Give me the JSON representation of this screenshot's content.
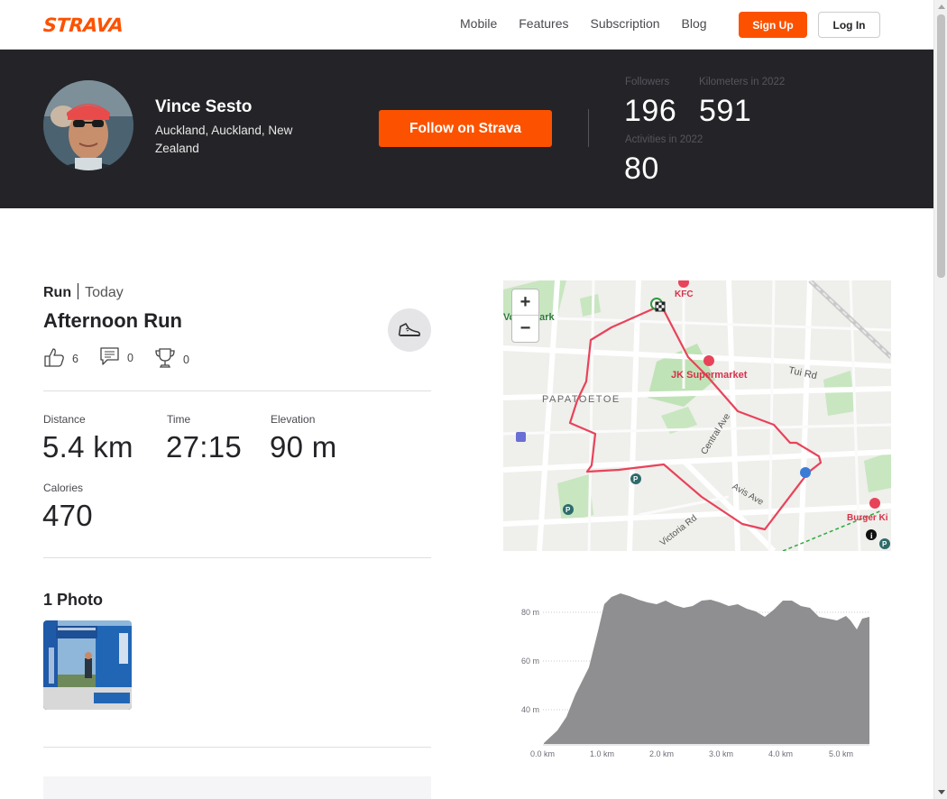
{
  "nav": {
    "logo": "STRAVA",
    "links": [
      "Mobile",
      "Features",
      "Subscription",
      "Blog"
    ],
    "signup": "Sign Up",
    "login": "Log In"
  },
  "athlete": {
    "name": "Vince Sesto",
    "location": "Auckland, Auckland, New Zealand",
    "follow_label": "Follow on Strava",
    "stats": {
      "followers_label": "Followers",
      "followers": "196",
      "km_label": "Kilometers in 2022",
      "km": "591",
      "activities_label": "Activities in 2022",
      "activities": "80"
    }
  },
  "activity": {
    "type": "Run",
    "when": "Today",
    "title": "Afternoon Run",
    "kudos": "6",
    "comments": "0",
    "achievements": "0",
    "metrics": {
      "distance_label": "Distance",
      "distance": "5.4 km",
      "time_label": "Time",
      "time": "27:15",
      "elevation_label": "Elevation",
      "elevation": "90 m",
      "calories_label": "Calories",
      "calories": "470"
    },
    "photos_title": "1 Photo"
  },
  "map": {
    "zoom_in": "+",
    "zoom_out": "−",
    "labels": {
      "park": "Volnd Park",
      "kfc": "KFC",
      "jk": "JK Supermarket",
      "suburb": "PAPATOETOE",
      "tui": "Tui Rd",
      "central": "Central Ave",
      "avis": "Avis Ave",
      "victoria": "Victoria Rd",
      "burger": "Burger Ki"
    }
  },
  "elevation_chart": {
    "y_ticks": [
      "80 m",
      "60 m",
      "40 m"
    ],
    "x_ticks": [
      "0.0 km",
      "1.0 km",
      "2.0 km",
      "3.0 km",
      "4.0 km",
      "5.0 km"
    ]
  },
  "colors": {
    "brand": "#fc5200",
    "header_bg": "#242428",
    "route": "#e8435a"
  }
}
